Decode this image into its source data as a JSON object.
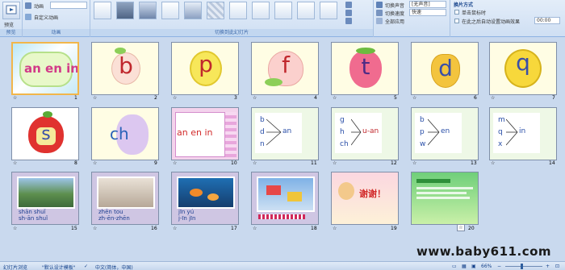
{
  "ribbon": {
    "preview_group": "预览",
    "preview_button": "预览",
    "animation_group": "动画",
    "animation_label": "动画",
    "animation_value": "",
    "custom_animation_label": "自定义动画",
    "transition_group": "切换到此幻灯片",
    "sound_label": "切换声音",
    "sound_value": "[无声音]",
    "speed_label": "切换速度",
    "speed_value": "快速",
    "apply_all_label": "全部应用",
    "advance_title": "换片方式",
    "on_click_label": "单击鼠标时",
    "auto_after_label": "在此之后自动设置动画效果",
    "auto_time": "00:00"
  },
  "slides": [
    {
      "num": "1",
      "text": "an en in"
    },
    {
      "num": "2",
      "text": "b"
    },
    {
      "num": "3",
      "text": "p"
    },
    {
      "num": "4",
      "text": "f"
    },
    {
      "num": "5",
      "text": "t"
    },
    {
      "num": "6",
      "text": "d"
    },
    {
      "num": "7",
      "text": "q"
    },
    {
      "num": "8",
      "text": "s"
    },
    {
      "num": "9",
      "text": "ch"
    },
    {
      "num": "10",
      "text": "an en in"
    },
    {
      "num": "11",
      "text": "b d n",
      "right": "an"
    },
    {
      "num": "12",
      "text": "g h ch",
      "right": "u-an"
    },
    {
      "num": "13",
      "text": "b p w",
      "right": "en"
    },
    {
      "num": "14",
      "text": "m q x",
      "right": "in"
    },
    {
      "num": "15",
      "text": "shān shuǐ",
      "sub": "sh-ān shuǐ"
    },
    {
      "num": "16",
      "text": "zhēn tou",
      "sub": "zh-ēn-zhēn"
    },
    {
      "num": "17",
      "text": "jīn yú",
      "sub": "j-īn jīn"
    },
    {
      "num": "18",
      "text": ""
    },
    {
      "num": "19",
      "text": "谢谢！"
    },
    {
      "num": "20",
      "text": ""
    }
  ],
  "slide_icon": "☆",
  "status": {
    "view": "幻灯片浏览",
    "theme": "\"默认设计模板\"",
    "language": "中文(简体，中国)",
    "zoom": "66%"
  },
  "watermark": "www.baby611.com",
  "colors": {
    "ribbon_bg": "#dbe7f6",
    "sorter_bg": "#c9d9ee",
    "selected_border": "#f2b64a"
  }
}
